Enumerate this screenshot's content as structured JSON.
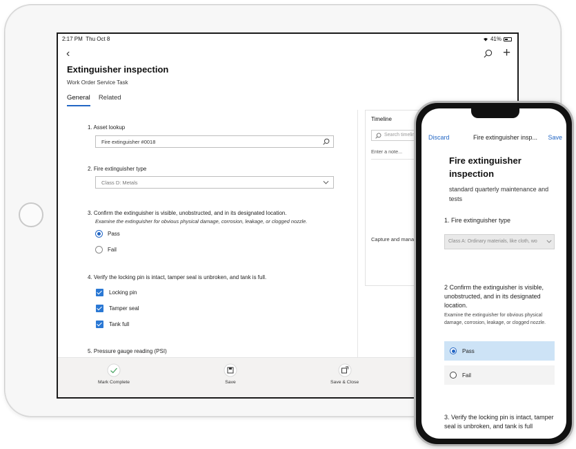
{
  "tablet": {
    "status": {
      "time": "2:17 PM",
      "date": "Thu Oct 8",
      "battery": "41%"
    },
    "title": "Extinguisher inspection",
    "subtitle": "Work Order Service Task",
    "tabs": [
      {
        "label": "General",
        "active": true
      },
      {
        "label": "Related",
        "active": false
      }
    ],
    "questions": {
      "q1": {
        "label": "1.  Asset lookup",
        "value": "Fire extinguisher #0018"
      },
      "q2": {
        "label": "2.  Fire extinguisher type",
        "value": "Class D: Metals"
      },
      "q3": {
        "label": "3.  Confirm the extinguisher is visible, unobstructed, and in its designated location.",
        "help": "Examine the extinguisher for obvious physical damage, corrosion, leakage, or clogged nozzle.",
        "options": [
          {
            "label": "Pass",
            "selected": true
          },
          {
            "label": "Fail",
            "selected": false
          }
        ]
      },
      "q4": {
        "label": "4.  Verify the locking pin is intact, tamper seal is unbroken, and tank is full.",
        "checks": [
          {
            "label": "Locking pin",
            "checked": true
          },
          {
            "label": "Tamper seal",
            "checked": true
          },
          {
            "label": "Tank full",
            "checked": true
          }
        ]
      },
      "q5": {
        "label": "5.  Pressure gauge reading (PSI)"
      }
    },
    "timeline": {
      "title": "Timeline",
      "search_placeholder": "Search timeline",
      "note_placeholder": "Enter a note...",
      "empty_title": "Ge",
      "empty_text": "Capture and mana"
    },
    "commands": {
      "mark_complete": "Mark Complete",
      "save": "Save",
      "save_close": "Save & Close"
    }
  },
  "phone": {
    "header": {
      "discard": "Discard",
      "title": "Fire extinguisher insp...",
      "save": "Save"
    },
    "title": "Fire extinguisher inspection",
    "subtitle": "standard quarterly maintenance and tests",
    "q1": {
      "label": "1. Fire extinguisher type",
      "value": "Class A: Ordinary materials, like cloth, wo"
    },
    "q2": {
      "label": "2 Confirm the extinguisher is visible, unobstructed, and in its designated location.",
      "help": "Examine the extinguisher for obvious physical damage, corrosion, leakage, or clogged nozzle.",
      "options": [
        {
          "label": "Pass",
          "selected": true
        },
        {
          "label": "Fail",
          "selected": false
        }
      ]
    },
    "q3": {
      "label": "3. Verify the locking pin is intact, tamper seal is unbroken, and tank is full"
    }
  },
  "colors": {
    "accent": "#2266c4",
    "selected_bg": "#cde3f6",
    "checkbox": "#2a78d4"
  }
}
